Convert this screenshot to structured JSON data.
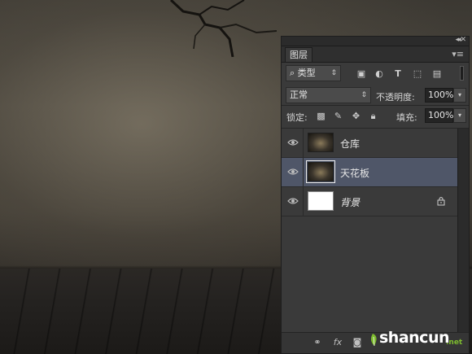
{
  "panel": {
    "tab_label": "图层",
    "filter": {
      "kind_label": "类型",
      "search_icon": "search-icon"
    },
    "blend": {
      "mode": "正常",
      "opacity_label": "不透明度:",
      "opacity_value": "100%"
    },
    "lock": {
      "label": "锁定:",
      "fill_label": "填充:",
      "fill_value": "100%"
    },
    "layers": [
      {
        "name": "仓库",
        "visible": true,
        "selected": false,
        "thumbnail": "image"
      },
      {
        "name": "天花板",
        "visible": true,
        "selected": true,
        "thumbnail": "image"
      },
      {
        "name": "背景",
        "visible": true,
        "selected": false,
        "thumbnail": "white",
        "locked": true
      }
    ],
    "bottom_fx_label": "fx"
  },
  "watermark": {
    "text": "shancun",
    "suffix": ".net"
  },
  "colors": {
    "panel_bg": "#3a3a3a",
    "selected_layer": "#4f5668",
    "watermark_green": "#7dbb2e"
  }
}
